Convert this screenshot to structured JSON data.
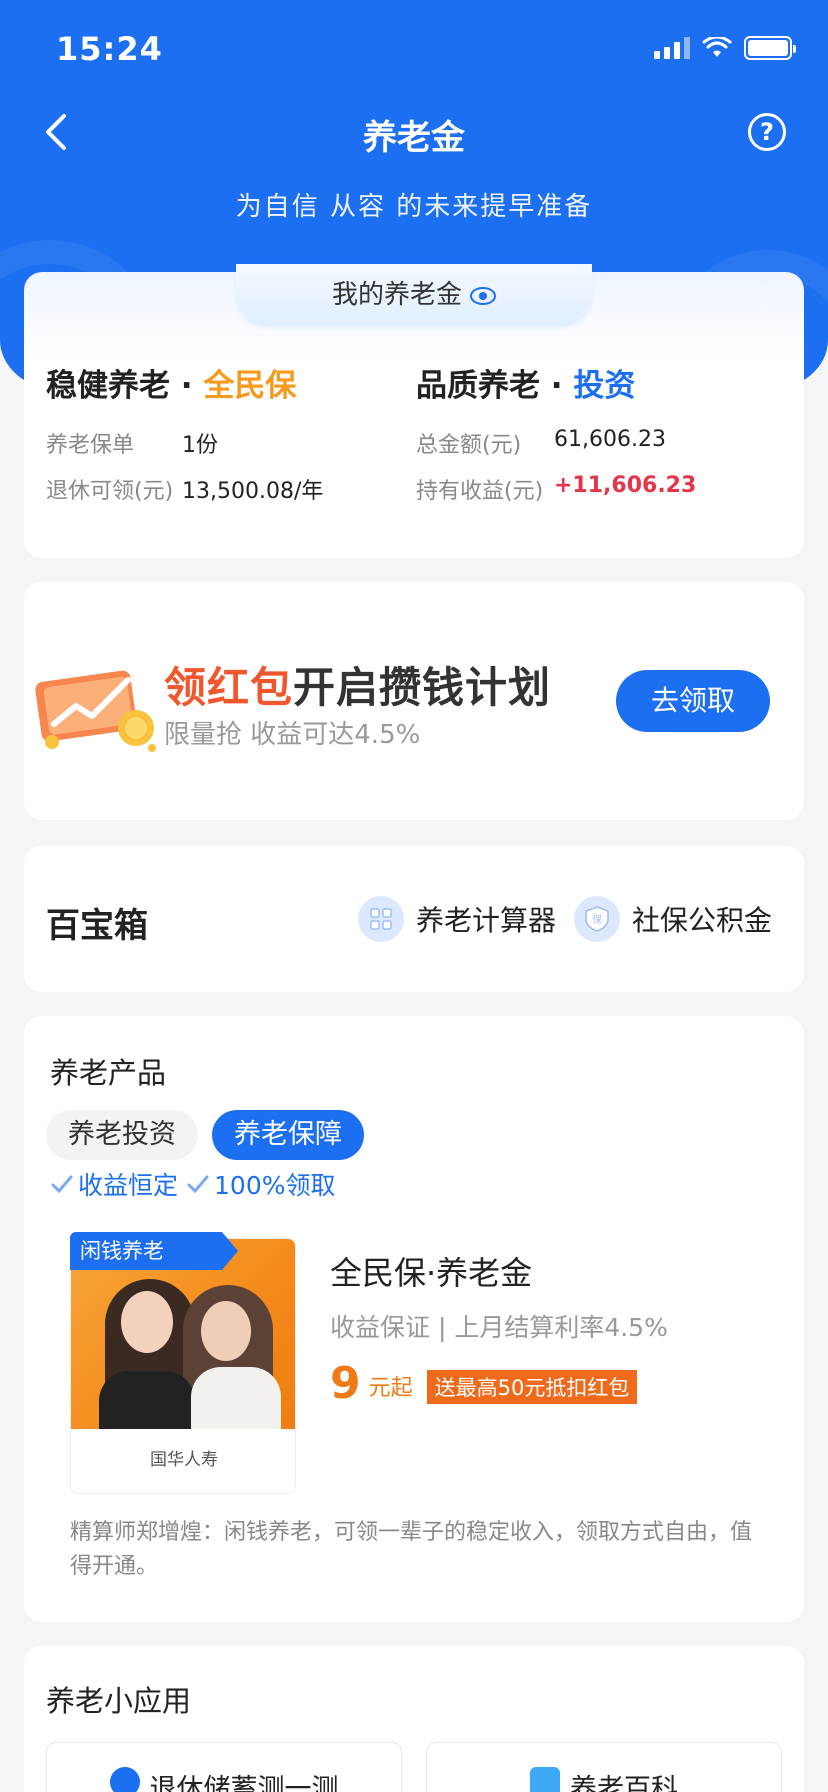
{
  "status_bar": {
    "time": "15:24"
  },
  "nav": {
    "title": "养老金",
    "help": "?"
  },
  "slogan": "为自信 从容 的未来提早准备",
  "my_pension": {
    "tab_label": "我的养老金",
    "left": {
      "title_prefix": "稳健养老 · ",
      "title_accent": "全民保",
      "rows": [
        {
          "label": "养老保单",
          "value": "1份"
        },
        {
          "label": "退休可领(元)",
          "value": "13,500.08/年"
        }
      ]
    },
    "right": {
      "title_prefix": "品质养老 · ",
      "title_accent": "投资",
      "rows": [
        {
          "label": "总金额(元)",
          "value": "61,606.23"
        },
        {
          "label": "持有收益(元)",
          "value": "+11,606.23"
        }
      ]
    }
  },
  "promo": {
    "title_red": "领红包",
    "title_rest": "开启攒钱计划",
    "subtitle": "限量抢 收益可达4.5%",
    "button": "去领取"
  },
  "toolbox": {
    "title": "百宝箱",
    "items": [
      {
        "label": "养老计算器",
        "icon": "calculator-icon"
      },
      {
        "label": "社保公积金",
        "icon": "shield-icon"
      }
    ]
  },
  "products": {
    "title": "养老产品",
    "tabs": [
      {
        "label": "养老投资",
        "active": false
      },
      {
        "label": "养老保障",
        "active": true
      }
    ],
    "tags": [
      "收益恒定",
      "100%领取"
    ],
    "item": {
      "badge": "闲钱养老",
      "company": "国华人寿",
      "name": "全民保·养老金",
      "desc": "收益保证 | 上月结算利率4.5%",
      "price": "9",
      "price_unit": "元起",
      "gift": "送最高50元抵扣红包",
      "quote": "精算师郑增煌：闲钱养老，可领一辈子的稳定收入，领取方式自由，值得开通。"
    }
  },
  "apps": {
    "title": "养老小应用",
    "items": [
      {
        "label": "退休储蓄测一测",
        "icon": "compass-icon"
      },
      {
        "label": "养老百科",
        "icon": "star-icon"
      }
    ]
  },
  "colors": {
    "primary": "#1d6ff2",
    "orange": "#f59a1c",
    "red": "#e5354a"
  }
}
